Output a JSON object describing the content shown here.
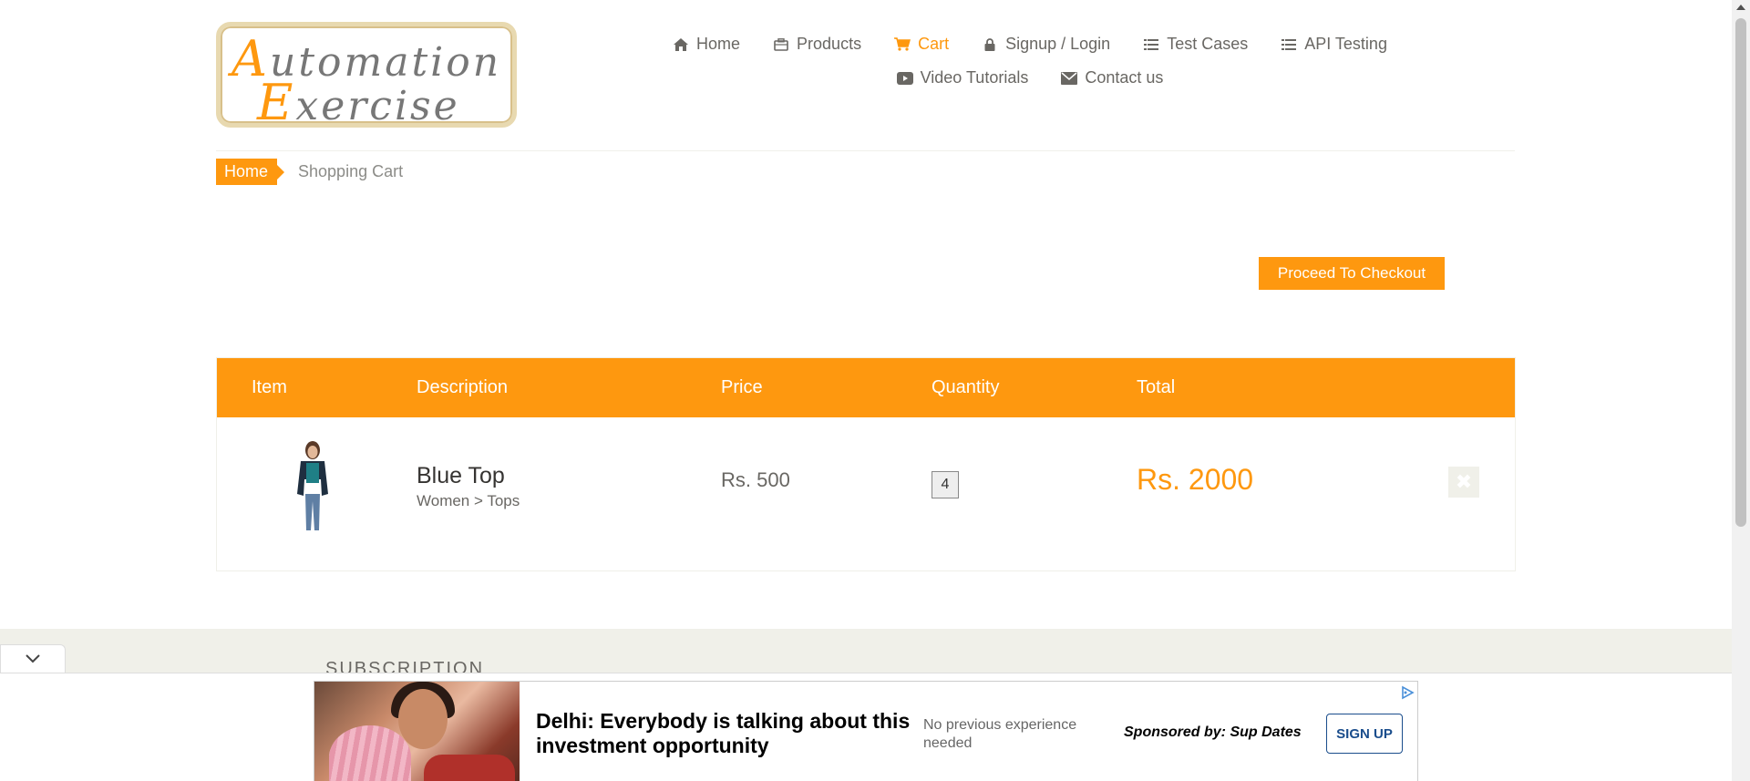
{
  "logo": {
    "line1_cap": "A",
    "line1_rest": "utomation",
    "line2_cap": "E",
    "line2_rest": "xercise"
  },
  "nav": {
    "row1": [
      {
        "label": "Home",
        "icon": "home-icon"
      },
      {
        "label": "Products",
        "icon": "briefcase-icon"
      },
      {
        "label": "Cart",
        "icon": "cart-icon",
        "active": true
      },
      {
        "label": "Signup / Login",
        "icon": "lock-icon"
      },
      {
        "label": "Test Cases",
        "icon": "list-icon"
      },
      {
        "label": "API Testing",
        "icon": "list-icon"
      }
    ],
    "row2": [
      {
        "label": "Video Tutorials",
        "icon": "youtube-play-icon"
      },
      {
        "label": "Contact us",
        "icon": "envelope-icon"
      }
    ]
  },
  "breadcrumb": {
    "home": "Home",
    "current": "Shopping Cart"
  },
  "checkout_button": "Proceed To Checkout",
  "cart": {
    "headers": {
      "item": "Item",
      "description": "Description",
      "price": "Price",
      "quantity": "Quantity",
      "total": "Total"
    },
    "rows": [
      {
        "name": "Blue Top",
        "category": "Women > Tops",
        "price": "Rs. 500",
        "quantity": "4",
        "total": "Rs. 2000"
      }
    ]
  },
  "footer": {
    "title": "SUBSCRIPTION"
  },
  "ad": {
    "headline": "Delhi: Everybody is talking about this investment opportunity",
    "sub": "No previous experience needed",
    "sponsor": "Sponsored by: Sup Dates",
    "cta": "SIGN UP"
  },
  "colors": {
    "accent": "#fe980f",
    "text": "#696763",
    "ad_cta": "#1a4d8c"
  }
}
